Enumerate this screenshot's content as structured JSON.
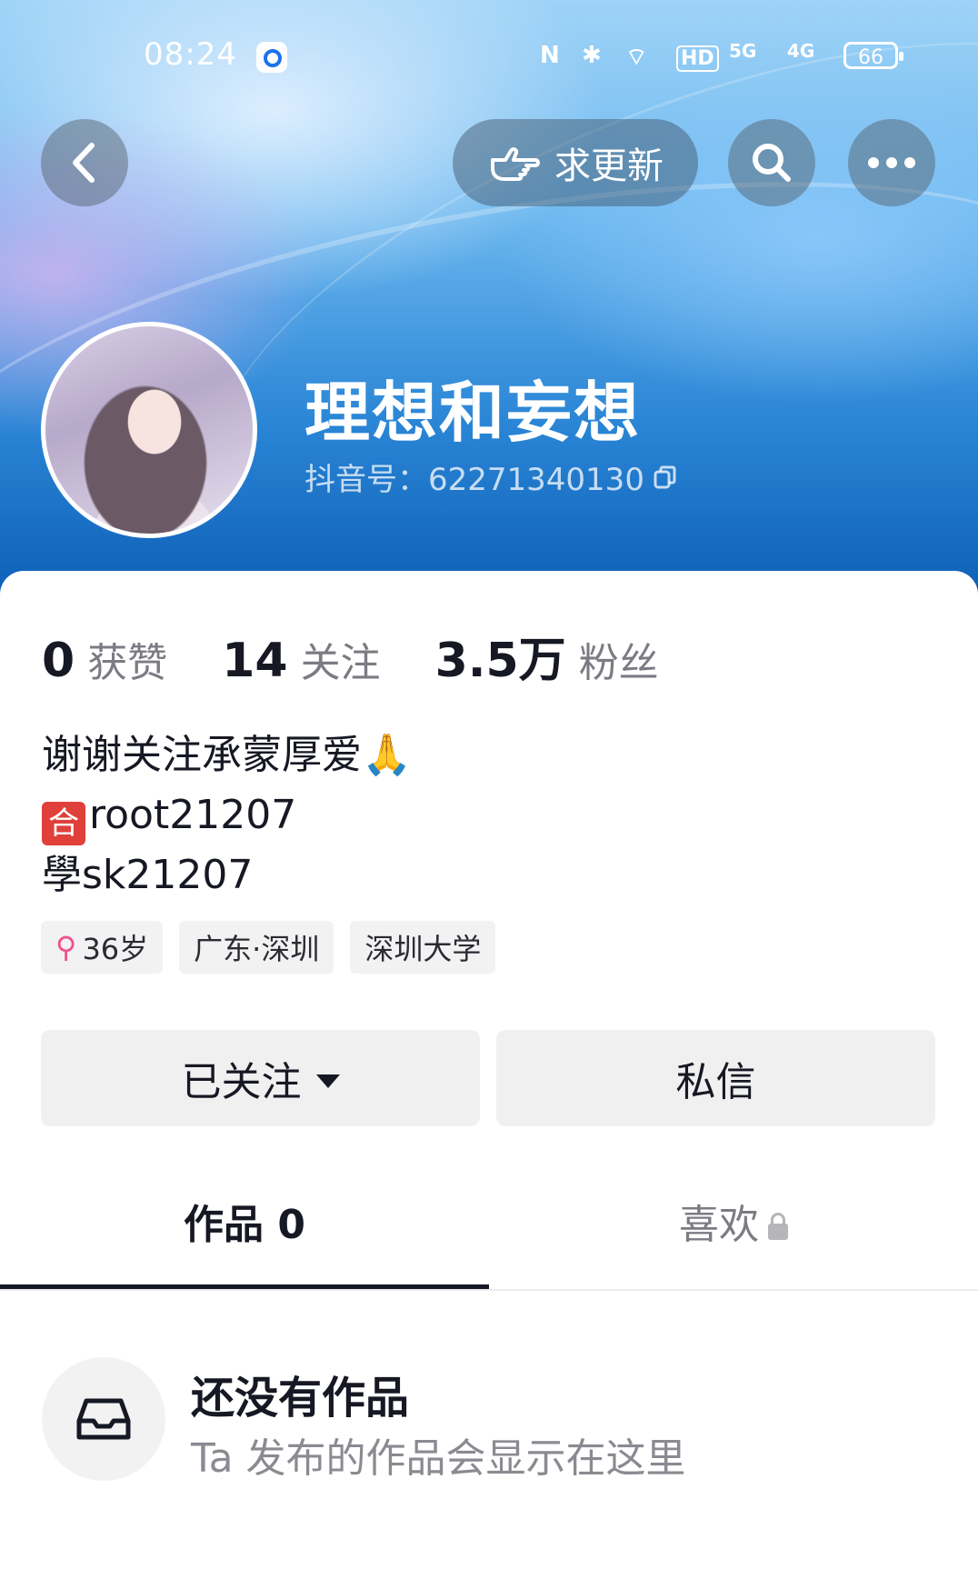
{
  "status_bar": {
    "time": "08:24",
    "icons": [
      "app-notification-icon",
      "nfc-icon",
      "bluetooth-icon",
      "wifi-icon",
      "hd-icon",
      "5g-signal-icon",
      "4g-signal-icon"
    ],
    "nfc": "N",
    "bluetooth": "✱",
    "wifi": "⌔",
    "hd": "HD",
    "signal_5g": "5G",
    "signal_4g": "4G",
    "battery": "66"
  },
  "header": {
    "request_update_label": "求更新"
  },
  "profile": {
    "nickname": "理想和妄想",
    "douyin_id": "抖音号：62271340130"
  },
  "stats": [
    {
      "value": "0",
      "label": "获赞"
    },
    {
      "value": "14",
      "label": "关注"
    },
    {
      "value": "3.5万",
      "label": "粉丝"
    }
  ],
  "bio": {
    "line1": "谢谢关注承蒙厚爱🙏",
    "line2_badge": "合",
    "line2_text": "root21207",
    "line3": "學sk21207"
  },
  "tags": {
    "gender_symbol": "⚲",
    "age": "36岁",
    "location": "广东·深圳",
    "school": "深圳大学"
  },
  "actions": {
    "follow_label": "已关注",
    "message_label": "私信"
  },
  "tabs": {
    "works_label": "作品 0",
    "liked_label": "喜欢"
  },
  "empty_state": {
    "title": "还没有作品",
    "subtitle": "Ta 发布的作品会显示在这里"
  },
  "colors": {
    "accent_text": "#161823",
    "secondary_text": "#7b7c83",
    "gender_pink": "#f0508c"
  }
}
